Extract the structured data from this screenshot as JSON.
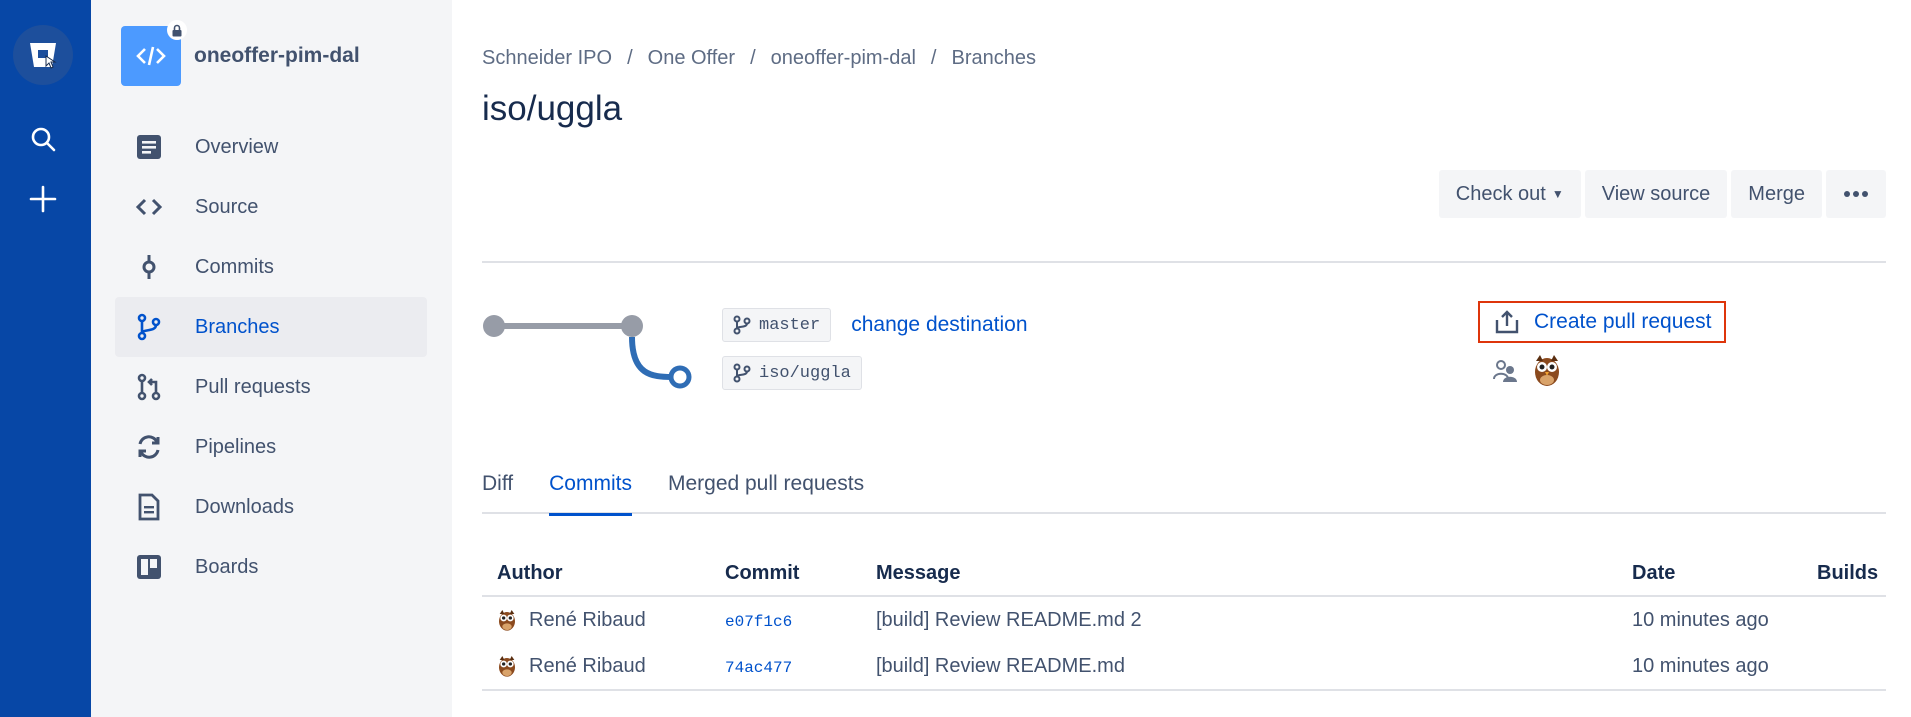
{
  "project": {
    "name": "oneoffer-pim-dal"
  },
  "sidebar": {
    "items": [
      {
        "label": "Overview",
        "icon": "overview-icon"
      },
      {
        "label": "Source",
        "icon": "code-icon"
      },
      {
        "label": "Commits",
        "icon": "commit-icon"
      },
      {
        "label": "Branches",
        "icon": "branch-icon",
        "active": true
      },
      {
        "label": "Pull requests",
        "icon": "pull-request-icon"
      },
      {
        "label": "Pipelines",
        "icon": "pipelines-icon"
      },
      {
        "label": "Downloads",
        "icon": "downloads-icon"
      },
      {
        "label": "Boards",
        "icon": "boards-icon"
      }
    ]
  },
  "breadcrumb": [
    "Schneider IPO",
    "One Offer",
    "oneoffer-pim-dal",
    "Branches"
  ],
  "page": {
    "title": "iso/uggla"
  },
  "actions": {
    "checkout": "Check out",
    "view_source": "View source",
    "merge": "Merge"
  },
  "branches": {
    "destination": "master",
    "source": "iso/uggla",
    "change_destination": "change destination"
  },
  "create_pr": {
    "label": "Create pull request"
  },
  "tabs": [
    "Diff",
    "Commits",
    "Merged pull requests"
  ],
  "active_tab": "Commits",
  "table": {
    "headers": {
      "author": "Author",
      "commit": "Commit",
      "message": "Message",
      "date": "Date",
      "builds": "Builds"
    },
    "rows": [
      {
        "author": "René Ribaud",
        "commit": "e07f1c6",
        "message": "[build] Review README.md 2",
        "date": "10 minutes ago"
      },
      {
        "author": "René Ribaud",
        "commit": "74ac477",
        "message": "[build] Review README.md",
        "date": "10 minutes ago"
      }
    ]
  },
  "colors": {
    "nav_blue": "#0747a6",
    "link_blue": "#0052cc",
    "highlight_red": "#de350b"
  }
}
